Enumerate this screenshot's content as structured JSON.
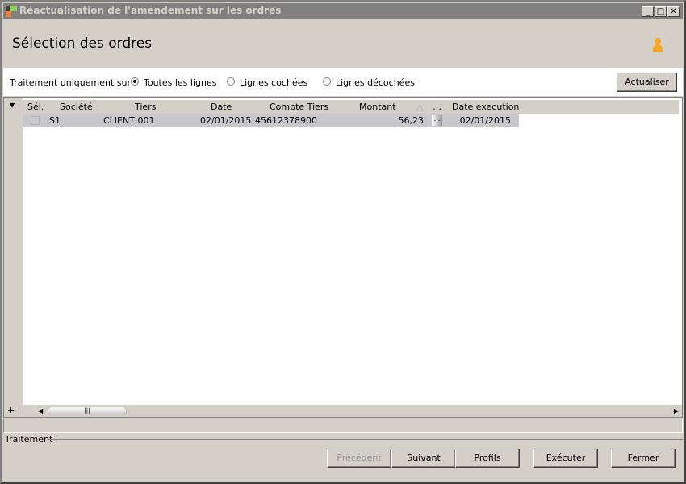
{
  "window": {
    "title": "Réactualisation de l'amendement sur les ordres",
    "minimize": "_",
    "maximize": "□",
    "close": "✕"
  },
  "header": {
    "title": "Sélection des ordres",
    "icon": "user-icon"
  },
  "options": {
    "label": "Traitement uniquement sur :",
    "radios": [
      {
        "label": "Toutes les lignes",
        "checked": true
      },
      {
        "label": "Lignes cochées",
        "checked": false
      },
      {
        "label": "Lignes décochées",
        "checked": false
      }
    ],
    "refresh": "Actualiser"
  },
  "grid": {
    "columns": [
      "Sél.",
      "Société",
      "Tiers",
      "Date",
      "Compte Tiers",
      "Montant",
      "…",
      "Date execution"
    ],
    "rows": [
      {
        "sel": false,
        "societe": "S1",
        "tiers": "CLIENT 001",
        "date": "02/01/2015",
        "compte": "45612378900",
        "montant": "56,23",
        "more": "...",
        "date_exec": "02/01/2015"
      }
    ],
    "add": "+"
  },
  "footer": {
    "group": "Traitement",
    "buttons": {
      "prev": "Précédent",
      "next": "Suivant",
      "profiles": "Profils",
      "execute": "Exécuter",
      "close": "Fermer"
    }
  },
  "colors": {
    "title_bar": "#808080",
    "accent": "#f5a623"
  }
}
